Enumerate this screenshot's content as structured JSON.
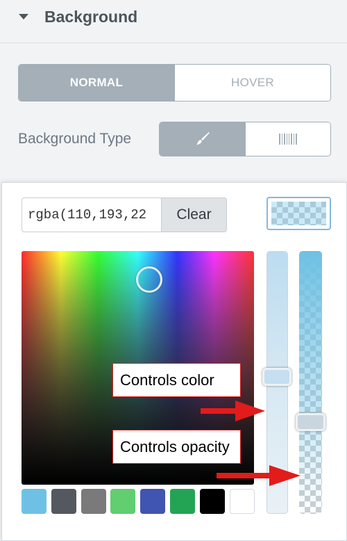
{
  "section": {
    "title": "Background",
    "icon": "caret-down-icon"
  },
  "state_tabs": [
    {
      "label": "NORMAL",
      "active": true
    },
    {
      "label": "HOVER",
      "active": false
    }
  ],
  "background_type": {
    "label": "Background Type",
    "options": [
      {
        "icon": "paint-brush-icon",
        "active": true
      },
      {
        "icon": "gradient-icon",
        "active": false
      }
    ]
  },
  "picker": {
    "color_value": "rgba(110,193,22",
    "clear_label": "Clear",
    "current_color": "rgba(110,193,228,0.35)",
    "preset_colors": [
      "#6ec1e4",
      "#54595f",
      "#7a7a7a",
      "#61ce70",
      "#4054b2",
      "#23a455",
      "#000000",
      "#ffffff"
    ]
  },
  "annotations": {
    "color_label": "Controls color",
    "opacity_label": "Controls opacity",
    "arrow_color": "#e21b1b"
  }
}
